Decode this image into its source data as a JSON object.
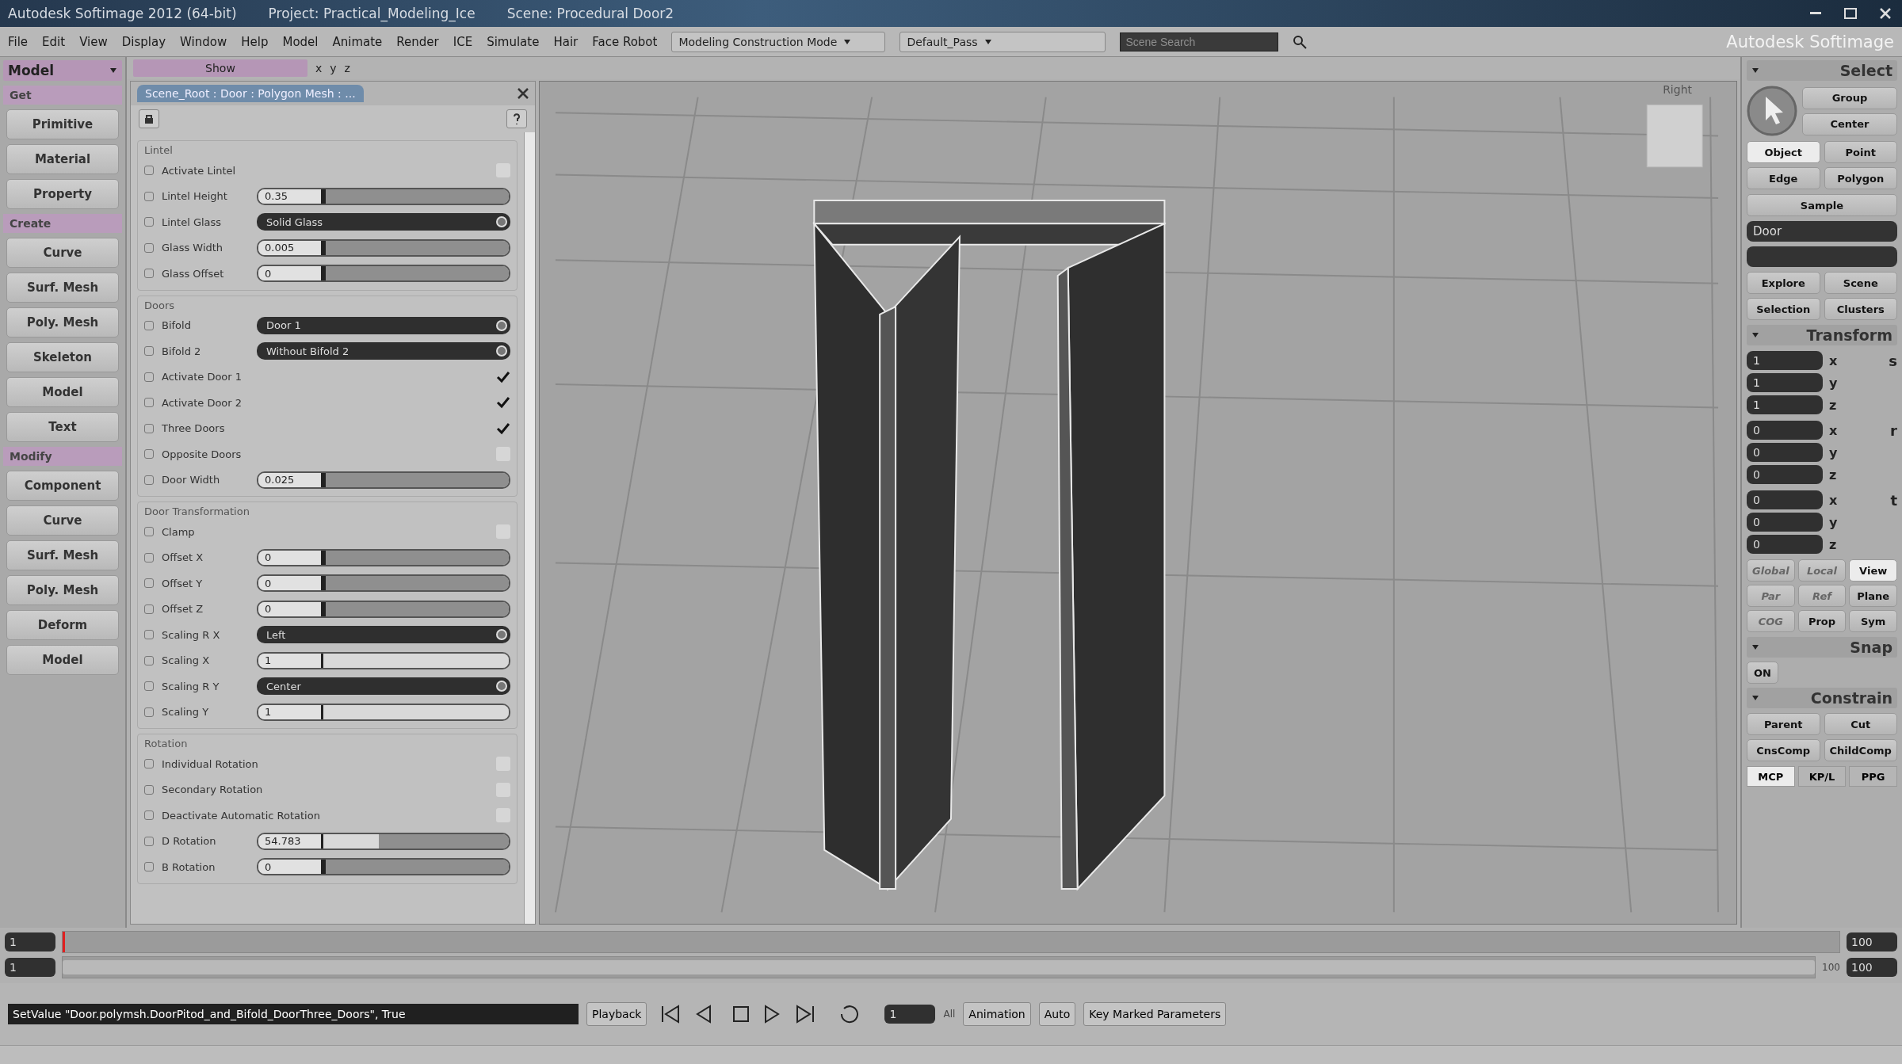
{
  "title_bar": {
    "app": "Autodesk Softimage 2012 (64-bit)",
    "project": "Project: Practical_Modeling_Ice",
    "scene": "Scene: Procedural Door2"
  },
  "menu_bar": {
    "items": [
      "File",
      "Edit",
      "View",
      "Display",
      "Window",
      "Help",
      "Model",
      "Animate",
      "Render",
      "ICE",
      "Simulate",
      "Hair",
      "Face Robot"
    ],
    "mode": "Modeling Construction Mode",
    "pass": "Default_Pass",
    "search_placeholder": "Scene Search",
    "brand": "Autodesk Softimage"
  },
  "left_toolbar": {
    "module": "Model",
    "sections": [
      {
        "title": "Get",
        "buttons": [
          "Primitive",
          "Material",
          "Property"
        ]
      },
      {
        "title": "Create",
        "buttons": [
          "Curve",
          "Surf. Mesh",
          "Poly. Mesh",
          "Skeleton",
          "Model",
          "Text"
        ]
      },
      {
        "title": "Modify",
        "buttons": [
          "Component",
          "Curve",
          "Surf. Mesh",
          "Poly. Mesh",
          "Deform",
          "Model"
        ]
      }
    ]
  },
  "view_toolbar": {
    "show": "Show",
    "axes": [
      "x",
      "y",
      "z"
    ]
  },
  "property_panel": {
    "title": "Scene_Root : Door : Polygon Mesh : ...",
    "groups": [
      {
        "title": "Lintel",
        "rows": [
          {
            "kind": "check",
            "label": "Activate Lintel",
            "checked": false
          },
          {
            "kind": "slider",
            "label": "Lintel Height",
            "value": "0.35",
            "level": 0
          },
          {
            "kind": "dropdown",
            "label": "Lintel Glass",
            "value": "Solid Glass"
          },
          {
            "kind": "slider",
            "label": "Glass Width",
            "value": "0.005",
            "level": 0
          },
          {
            "kind": "slider",
            "label": "Glass Offset",
            "value": "0",
            "level": 0
          }
        ]
      },
      {
        "title": "Doors",
        "rows": [
          {
            "kind": "dropdown",
            "label": "Bifold",
            "value": "Door 1"
          },
          {
            "kind": "dropdown",
            "label": "Bifold 2",
            "value": "Without Bifold 2"
          },
          {
            "kind": "check",
            "label": "Activate Door 1",
            "checked": true
          },
          {
            "kind": "check",
            "label": "Activate Door 2",
            "checked": true
          },
          {
            "kind": "check",
            "label": "Three Doors",
            "checked": true
          },
          {
            "kind": "check",
            "label": "Opposite Doors",
            "checked": false
          },
          {
            "kind": "slider",
            "label": "Door Width",
            "value": "0.025",
            "level": 0
          }
        ]
      },
      {
        "title": "Door Transformation",
        "rows": [
          {
            "kind": "check",
            "label": "Clamp",
            "checked": false
          },
          {
            "kind": "slider",
            "label": "Offset X",
            "value": "0",
            "level": 0
          },
          {
            "kind": "slider",
            "label": "Offset Y",
            "value": "0",
            "level": 0
          },
          {
            "kind": "slider",
            "label": "Offset Z",
            "value": "0",
            "level": 0
          },
          {
            "kind": "dropdown",
            "label": "Scaling R X",
            "value": "Left"
          },
          {
            "kind": "slider",
            "label": "Scaling X",
            "value": "1",
            "level": 1
          },
          {
            "kind": "dropdown",
            "label": "Scaling R Y",
            "value": "Center"
          },
          {
            "kind": "slider",
            "label": "Scaling Y",
            "value": "1",
            "level": 1
          }
        ]
      },
      {
        "title": "Rotation",
        "rows": [
          {
            "kind": "check",
            "label": "Individual Rotation",
            "checked": false
          },
          {
            "kind": "check",
            "label": "Secondary Rotation",
            "checked": false
          },
          {
            "kind": "check",
            "label": "Deactivate Automatic Rotation",
            "checked": false
          },
          {
            "kind": "slider",
            "label": "D Rotation",
            "value": "54.783",
            "level": 0.3
          },
          {
            "kind": "slider",
            "label": "B Rotation",
            "value": "0",
            "level": 0
          }
        ]
      }
    ]
  },
  "viewport": {
    "label": "Right"
  },
  "right_panel": {
    "select_title": "Select",
    "select_buttons": [
      {
        "label": "Group"
      },
      {
        "label": "Center"
      }
    ],
    "components": [
      {
        "label": "Object",
        "selected": true
      },
      {
        "label": "Point",
        "selected": false
      },
      {
        "label": "Edge",
        "selected": false
      },
      {
        "label": "Polygon",
        "selected": false
      }
    ],
    "sample": "Sample",
    "name_field": "Door",
    "explore_buttons": [
      "Explore",
      "Scene",
      "Selection",
      "Clusters"
    ],
    "transform_title": "Transform",
    "transform_groups": [
      {
        "symbol": "s",
        "fields": [
          {
            "axis": "x",
            "value": "1"
          },
          {
            "axis": "y",
            "value": "1"
          },
          {
            "axis": "z",
            "value": "1"
          }
        ]
      },
      {
        "symbol": "r",
        "fields": [
          {
            "axis": "x",
            "value": "0"
          },
          {
            "axis": "y",
            "value": "0"
          },
          {
            "axis": "z",
            "value": "0"
          }
        ]
      },
      {
        "symbol": "t",
        "fields": [
          {
            "axis": "x",
            "value": "0"
          },
          {
            "axis": "y",
            "value": "0"
          },
          {
            "axis": "z",
            "value": "0"
          }
        ]
      }
    ],
    "space_buttons": [
      {
        "label": "Global",
        "selected": false,
        "disabled": true
      },
      {
        "label": "Local",
        "selected": false,
        "disabled": true
      },
      {
        "label": "View",
        "selected": true,
        "disabled": false
      },
      {
        "label": "Par",
        "selected": false,
        "disabled": true
      },
      {
        "label": "Ref",
        "selected": false,
        "disabled": true
      },
      {
        "label": "Plane",
        "selected": false,
        "disabled": false
      },
      {
        "label": "COG",
        "selected": false,
        "disabled": true
      },
      {
        "label": "Prop",
        "selected": false,
        "disabled": false
      },
      {
        "label": "Sym",
        "selected": false,
        "disabled": false
      }
    ],
    "snap_title": "Snap",
    "snap_on": "ON",
    "constrain_title": "Constrain",
    "constrain_buttons": [
      "Parent",
      "Cut",
      "CnsComp",
      "ChildComp"
    ],
    "tabs": [
      {
        "label": "MCP",
        "selected": true
      },
      {
        "label": "KP/L",
        "selected": false
      },
      {
        "label": "PPG",
        "selected": false
      }
    ]
  },
  "timeline": {
    "start": "1",
    "end": "100",
    "range_start": "1",
    "range_end": "100",
    "range_end_label": "100",
    "cursor": {
      "level": 0
    },
    "range": {
      "level": 1
    }
  },
  "command_bar": {
    "command": "SetValue \"Door.polymsh.DoorPitod_and_Bifold_DoorThree_Doors\", True",
    "playback": "Playback",
    "frame": "1",
    "all": "All",
    "animation": "Animation",
    "auto": "Auto",
    "key_marked": "Key Marked Parameters"
  }
}
